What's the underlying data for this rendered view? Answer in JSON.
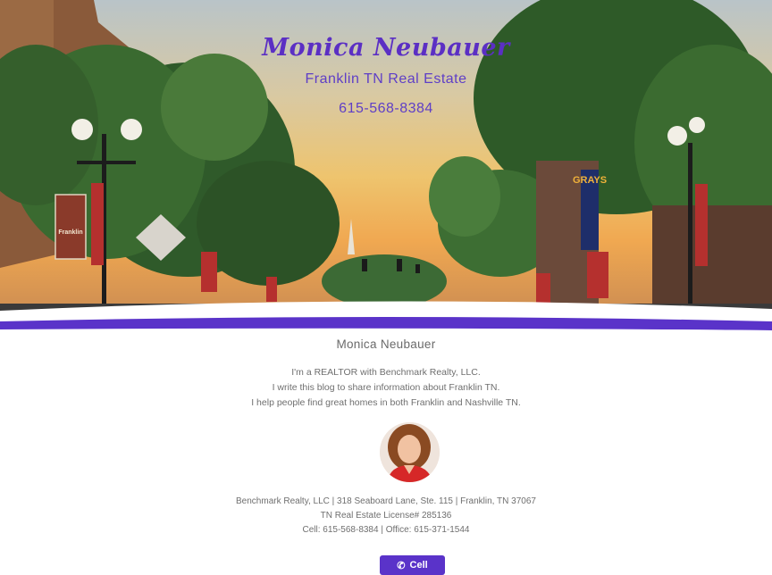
{
  "hero": {
    "name": "Monica Neubauer",
    "subtitle": "Franklin TN Real Estate",
    "phone": "615-568-8384",
    "store_signs": [
      "GRAYS",
      "Franklin"
    ]
  },
  "colors": {
    "accent": "#5a33c9",
    "text_gray": "#6f6f6f"
  },
  "profile": {
    "name": "Monica Neubauer",
    "bio": [
      "I'm a REALTOR with Benchmark Realty, LLC.",
      "I write this blog to share information about Franklin TN.",
      "I help people find great homes in both Franklin and Nashville TN."
    ]
  },
  "contact": {
    "lines": [
      "Benchmark Realty, LLC | 318 Seaboard Lane, Ste. 115 | Franklin, TN 37067",
      "TN Real Estate License# 285136",
      "Cell: 615-568-8384 | Office: 615-371-1544"
    ]
  },
  "buttons": {
    "cell_label": "Cell",
    "cell_icon": "phone-icon"
  }
}
